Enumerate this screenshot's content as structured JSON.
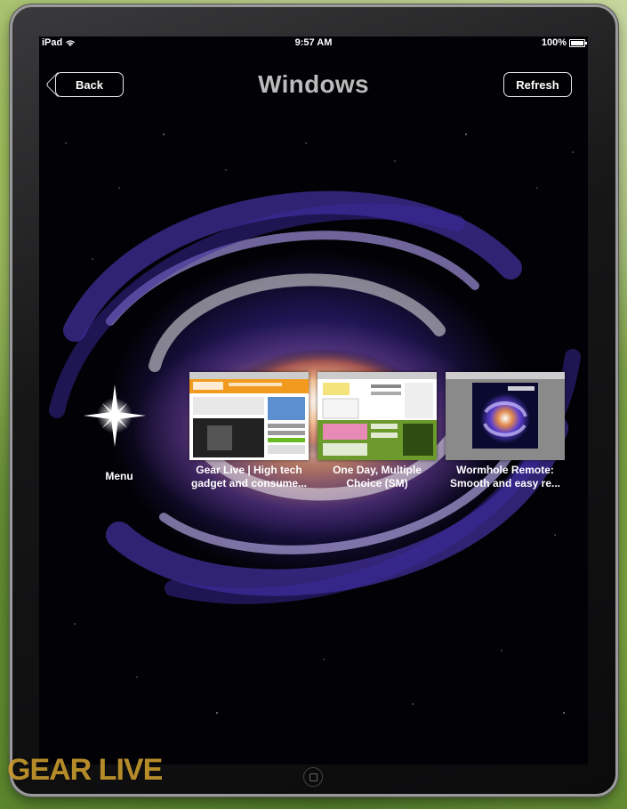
{
  "status_bar": {
    "carrier": "iPad",
    "time": "9:57 AM",
    "battery": "100%"
  },
  "nav": {
    "title": "Windows",
    "back_label": "Back",
    "refresh_label": "Refresh"
  },
  "menu": {
    "label": "Menu",
    "icon": "star-icon"
  },
  "windows": [
    {
      "caption_line1": "Gear Live | High tech",
      "caption_line2": "gadget and consume..."
    },
    {
      "caption_line1": "One Day, Multiple",
      "caption_line2": "Choice (SM)"
    },
    {
      "caption_line1": "Wormhole Remote:",
      "caption_line2": "Smooth and easy re..."
    }
  ],
  "watermark": "GEAR LIVE"
}
